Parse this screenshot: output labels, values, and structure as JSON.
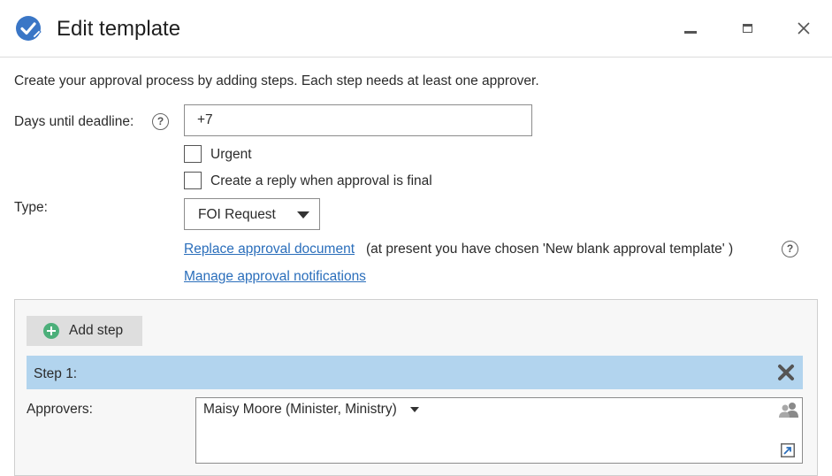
{
  "window": {
    "title": "Edit template",
    "controls": {
      "minimize": "minimize-icon",
      "maximize": "maximize-icon",
      "close": "close-icon"
    }
  },
  "intro_text": "Create your approval process by adding steps. Each step needs at least one approver.",
  "deadline": {
    "label": "Days until deadline:",
    "value": "+7",
    "help_icon": "help-circle-icon"
  },
  "options": {
    "urgent": {
      "label": "Urgent",
      "checked": false
    },
    "reply_final": {
      "label": "Create a reply when approval is final",
      "checked": false
    }
  },
  "type": {
    "label": "Type:",
    "selected": "FOI Request"
  },
  "links": {
    "replace_document": "Replace approval document",
    "present_note": "(at present you have chosen 'New blank approval template' )",
    "manage_notifications": "Manage approval notifications"
  },
  "steps": {
    "add_step_label": "Add step",
    "items": [
      {
        "title": "Step 1:",
        "approvers_label": "Approvers:",
        "approvers": [
          "Maisy Moore (Minister, Ministry)"
        ]
      }
    ]
  },
  "colors": {
    "accent": "#2a6ebb",
    "step_header": "#b2d4ee",
    "add_icon": "#4caf7a",
    "button_bg": "#dedede"
  }
}
